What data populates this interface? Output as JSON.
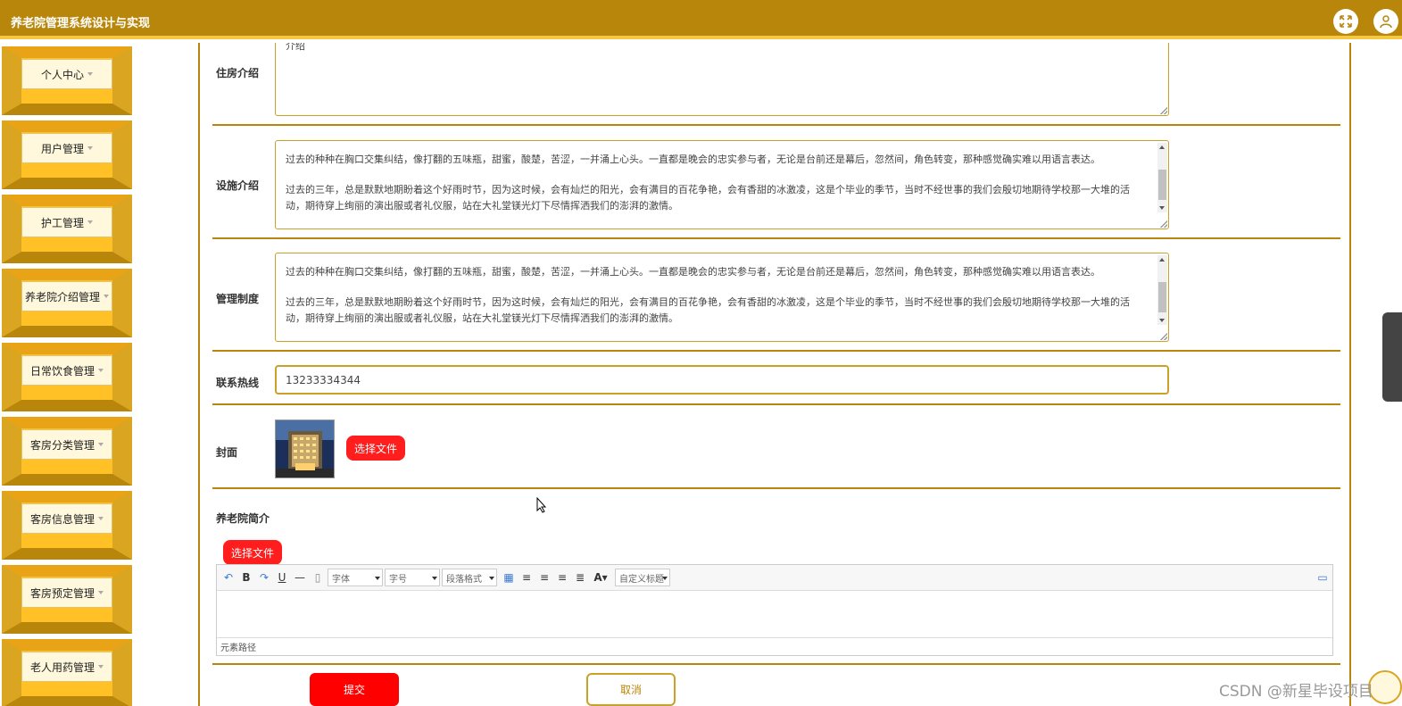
{
  "header": {
    "title": "养老院管理系统设计与实现",
    "fullscreen_icon": "expand-icon",
    "user_icon": "user-icon"
  },
  "sidebar": {
    "items": [
      {
        "label": "个人中心"
      },
      {
        "label": "用户管理"
      },
      {
        "label": "护工管理"
      },
      {
        "label": "养老院介绍管理"
      },
      {
        "label": "日常饮食管理"
      },
      {
        "label": "客房分类管理"
      },
      {
        "label": "客房信息管理"
      },
      {
        "label": "客房预定管理"
      },
      {
        "label": "老人用药管理"
      }
    ]
  },
  "form": {
    "housing": {
      "label": "住房介绍",
      "value": "介绍"
    },
    "facilities": {
      "label": "设施介绍",
      "p1": "过去的种种在胸口交集纠结，像打翻的五味瓶，甜蜜，酸楚，苦涩，一并涌上心头。一直都是晚会的忠实参与者，无论是台前还是幕后，忽然间，角色转变，那种感觉确实难以用语言表达。",
      "p2": "过去的三年，总是默默地期盼着这个好雨时节，因为这时候，会有灿烂的阳光，会有满目的百花争艳，会有香甜的冰激凌，这是个毕业的季节，当时不经世事的我们会殷切地期待学校那一大堆的活动，期待穿上绚丽的演出服或者礼仪服，站在大礼堂镁光灯下尽情挥洒我们的澎湃的激情。"
    },
    "rules": {
      "label": "管理制度",
      "p1": "过去的种种在胸口交集纠结，像打翻的五味瓶，甜蜜，酸楚，苦涩，一并涌上心头。一直都是晚会的忠实参与者，无论是台前还是幕后，忽然间，角色转变，那种感觉确实难以用语言表达。",
      "p2": "过去的三年，总是默默地期盼着这个好雨时节，因为这时候，会有灿烂的阳光，会有满目的百花争艳，会有香甜的冰激凌，这是个毕业的季节，当时不经世事的我们会殷切地期待学校那一大堆的活动，期待穿上绚丽的演出服或者礼仪服，站在大礼堂镁光灯下尽情挥洒我们的澎湃的激情。"
    },
    "hotline": {
      "label": "联系热线",
      "value": "13233334344"
    },
    "cover": {
      "label": "封面",
      "upload_label": "选择文件"
    },
    "intro": {
      "label": "养老院简介",
      "upload_label": "选择文件"
    },
    "editor": {
      "font_select": "字体",
      "size_select": "字号",
      "para_select": "段落格式",
      "custom_select": "自定义标题",
      "status": "元素路径"
    },
    "submit_label": "提交",
    "cancel_label": "取消"
  },
  "watermark": "CSDN @新星毕设项目",
  "colors": {
    "primary": "#b8860b",
    "accent": "#ffc125",
    "danger": "#ff0000"
  }
}
